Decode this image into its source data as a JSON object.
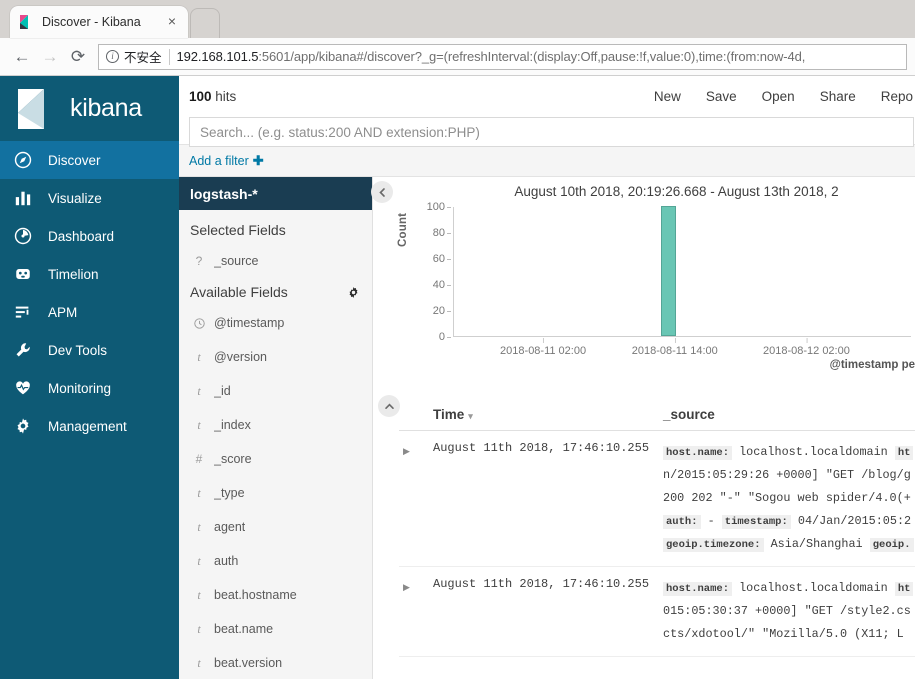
{
  "browser": {
    "tab_title": "Discover - Kibana",
    "close_label": "×",
    "back_label": "←",
    "forward_label": "→",
    "reload_label": "⟳",
    "security_label": "不安全",
    "url_main": "192.168.101.5",
    "url_rest": ":5601/app/kibana#/discover?_g=(refreshInterval:(display:Off,pause:!f,value:0),time:(from:now-4d,"
  },
  "nav": {
    "brand": "kibana",
    "items": [
      {
        "label": "Discover",
        "icon": "compass-icon",
        "active": true
      },
      {
        "label": "Visualize",
        "icon": "barchart-icon",
        "active": false
      },
      {
        "label": "Dashboard",
        "icon": "dashboard-icon",
        "active": false
      },
      {
        "label": "Timelion",
        "icon": "timelion-icon",
        "active": false
      },
      {
        "label": "APM",
        "icon": "apm-icon",
        "active": false
      },
      {
        "label": "Dev Tools",
        "icon": "wrench-icon",
        "active": false
      },
      {
        "label": "Monitoring",
        "icon": "heartbeat-icon",
        "active": false
      },
      {
        "label": "Management",
        "icon": "gear-icon",
        "active": false
      }
    ]
  },
  "topbar": {
    "hits_count": "100",
    "hits_suffix": " hits",
    "actions": [
      "New",
      "Save",
      "Open",
      "Share",
      "Repo"
    ],
    "search_value": "",
    "search_placeholder": "Search... (e.g. status:200 AND extension:PHP)"
  },
  "filterbar": {
    "add_filter_label": "Add a filter",
    "plus": "✚"
  },
  "sidebar": {
    "index_pattern": "logstash-*",
    "selected_fields_title": "Selected Fields",
    "selected_fields": [
      {
        "name": "_source",
        "type": "?"
      }
    ],
    "available_fields_title": "Available Fields",
    "available_fields": [
      {
        "name": "@timestamp",
        "type": "clock"
      },
      {
        "name": "@version",
        "type": "t"
      },
      {
        "name": "_id",
        "type": "t"
      },
      {
        "name": "_index",
        "type": "t"
      },
      {
        "name": "_score",
        "type": "#"
      },
      {
        "name": "_type",
        "type": "t"
      },
      {
        "name": "agent",
        "type": "t"
      },
      {
        "name": "auth",
        "type": "t"
      },
      {
        "name": "beat.hostname",
        "type": "t"
      },
      {
        "name": "beat.name",
        "type": "t"
      },
      {
        "name": "beat.version",
        "type": "t"
      }
    ]
  },
  "chart_data": {
    "type": "bar",
    "title": "August 10th 2018, 20:19:26.668 - August 13th 2018, 2",
    "xlabel": "@timestamp pe",
    "ylabel": "Count",
    "ylim": [
      0,
      100
    ],
    "yticks": [
      0,
      20,
      40,
      60,
      80,
      100
    ],
    "xticks": [
      "2018-08-11 02:00",
      "2018-08-11 14:00",
      "2018-08-12 02:00"
    ],
    "xtick_positions_pct": [
      19.5,
      48.0,
      76.5
    ],
    "categories": [
      "2018-08-11 13:00"
    ],
    "values": [
      100
    ],
    "bar_position_pct": 45.2,
    "bar_color": "#69c6b4",
    "grid": false,
    "legend": false
  },
  "table": {
    "col_time": "Time",
    "col_source": "_source",
    "sort_caret": "▾",
    "expander": "▶",
    "rows": [
      {
        "time": "August 11th 2018, 17:46:10.255",
        "lines": [
          {
            "key": "host.name:",
            "text": " localhost.localdomain ",
            "key2": "ht"
          },
          {
            "text": "n/2015:05:29:26 +0000] \"GET /blog/g"
          },
          {
            "text": "200 202 \"-\" \"Sogou web spider/4.0(+"
          },
          {
            "key": "auth:",
            "text": " - ",
            "key2": "timestamp:",
            "text2": " 04/Jan/2015:05:2"
          },
          {
            "key": "geoip.timezone:",
            "text": " Asia/Shanghai ",
            "key2": "geoip."
          }
        ]
      },
      {
        "time": "August 11th 2018, 17:46:10.255",
        "lines": [
          {
            "key": "host.name:",
            "text": " localhost.localdomain ",
            "key2": "ht"
          },
          {
            "text": "015:05:30:37 +0000] \"GET /style2.cs"
          },
          {
            "text": "cts/xdotool/\" \"Mozilla/5.0 (X11; L"
          }
        ]
      }
    ]
  }
}
